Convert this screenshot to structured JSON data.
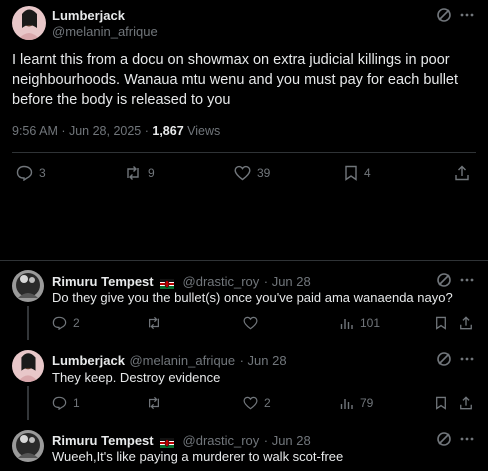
{
  "main_post": {
    "author_name": "Lumberjack",
    "author_handle": "@melanin_afrique",
    "text": "I learnt this from a docu on showmax on extra judicial killings in poor neighbourhoods. Wanaua mtu wenu and you must pay for each bullet before the body is released to you",
    "time": "9:56 AM · Jun 28, 2025 · ",
    "views_count": "1,867",
    "views_label": "Views",
    "replies": "3",
    "reposts": "9",
    "likes": "39",
    "bookmarks": "4",
    "icons": [
      "grok-icon",
      "more-icon",
      "reply-icon",
      "repost-icon",
      "like-icon",
      "bookmark-icon",
      "share-icon"
    ]
  },
  "replies": [
    {
      "author_name": "Rimuru Tempest",
      "flag": "kenya-flag",
      "author_handle": "@drastic_roy",
      "date": "· Jun 28",
      "text": "Do they give you the bullet(s) once you've paid ama wanaenda nayo?",
      "replies": "2",
      "reposts": "",
      "likes": "",
      "views": "101"
    },
    {
      "author_name": "Lumberjack",
      "flag": "",
      "author_handle": "@melanin_afrique",
      "date": "· Jun 28",
      "text": "They keep. Destroy evidence",
      "replies": "1",
      "reposts": "",
      "likes": "2",
      "views": "79"
    },
    {
      "author_name": "Rimuru Tempest",
      "flag": "kenya-flag",
      "author_handle": "@drastic_roy",
      "date": "· Jun 28",
      "text": "Wueeh,It's like paying a murderer to walk scot-free"
    }
  ],
  "colors": {
    "background": "#000000",
    "text": "#e7e9ea",
    "muted": "#71767b",
    "divider": "#2f3336"
  }
}
